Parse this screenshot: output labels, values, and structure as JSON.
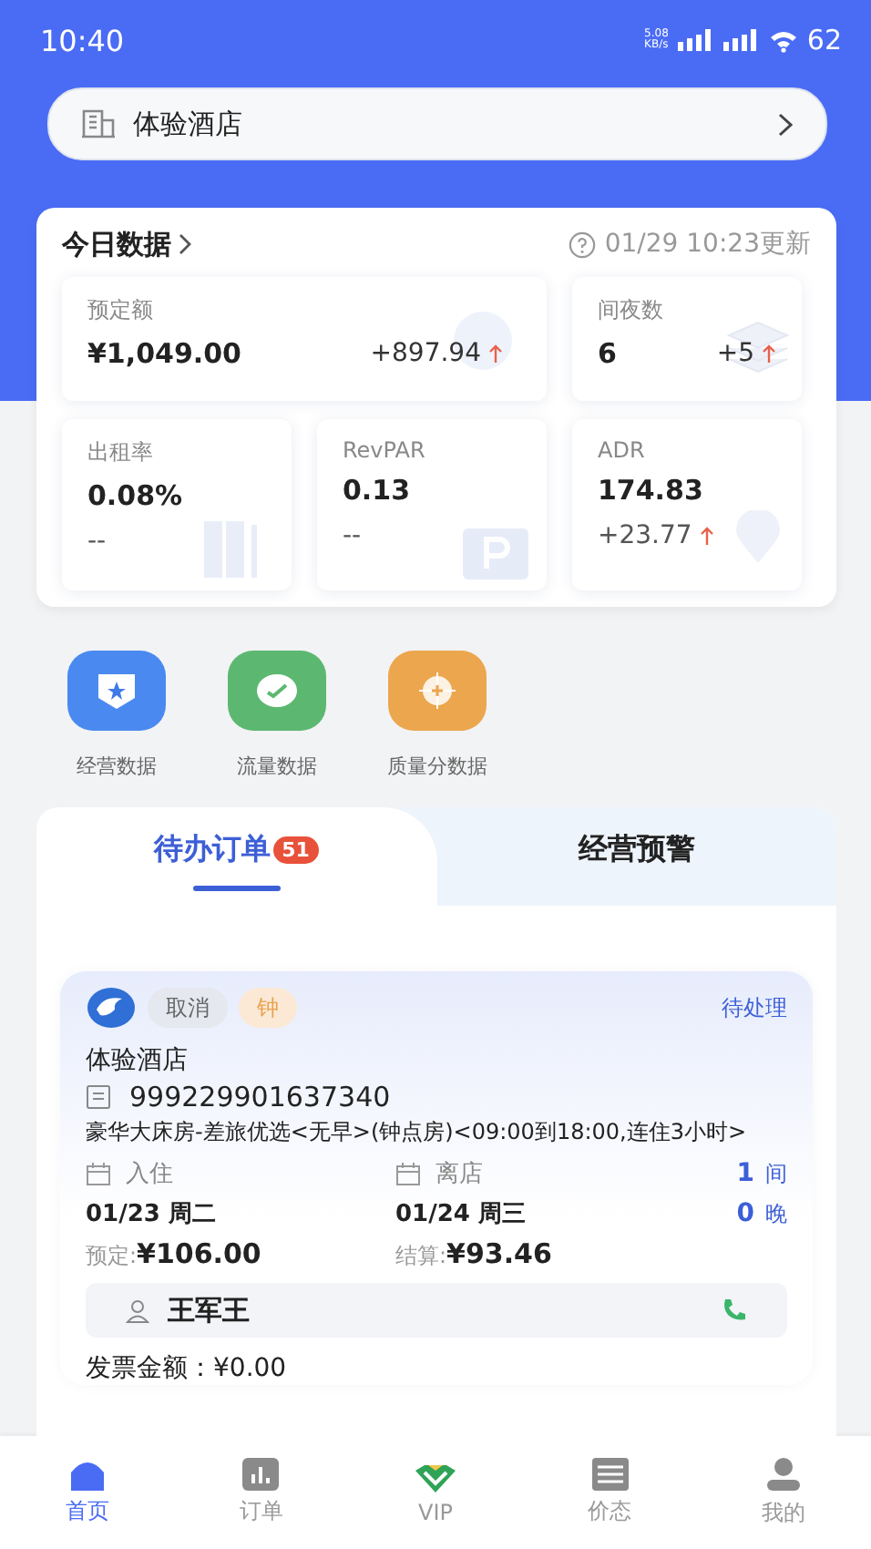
{
  "status_bar": {
    "time": "10:40",
    "net_speed": "5.08",
    "net_unit": "KB/s",
    "battery": "62"
  },
  "hotel_selector": {
    "name": "体验酒店"
  },
  "today_data": {
    "title": "今日数据",
    "updated": "01/29 10:23更新",
    "tiles": [
      {
        "label": "预定额",
        "value": "¥1,049.00",
        "change": "+897.94",
        "rising": true,
        "wide": true
      },
      {
        "label": "间夜数",
        "value": "6",
        "change": "+5",
        "rising": true,
        "wide": false
      },
      {
        "label": "出租率",
        "value": "0.08%",
        "change": "--",
        "wide": false
      },
      {
        "label": "RevPAR",
        "value": "0.13",
        "change": "--",
        "wide": false
      },
      {
        "label": "ADR",
        "value": "174.83",
        "change": "+23.77",
        "rising": true,
        "wide": false
      }
    ]
  },
  "quick_links": [
    {
      "label": "经营数据",
      "color": "#4a8af0"
    },
    {
      "label": "流量数据",
      "color": "#5cb870"
    },
    {
      "label": "质量分数据",
      "color": "#eca64e"
    }
  ],
  "tabs": [
    {
      "label": "待办订单",
      "badge": "51",
      "selected": true
    },
    {
      "label": "经营预警",
      "selected": false
    }
  ],
  "order": {
    "tags": [
      {
        "label": "取消",
        "kind": "grey"
      },
      {
        "label": "钟",
        "kind": "orange"
      }
    ],
    "status": "待处理",
    "hotel": "体验酒店",
    "order_no": "999229901637340",
    "room": "豪华大床房-差旅优选<无早>(钟点房)<09:00到18:00,连住3小时>",
    "checkin_label": "入住",
    "checkin_date": "01/23 周二",
    "checkout_label": "离店",
    "checkout_date": "01/24 周三",
    "rooms": "1",
    "rooms_unit": "间",
    "nights": "0",
    "nights_unit": "晚",
    "booked_label": "预定:",
    "booked_amount": "¥106.00",
    "settle_label": "结算:",
    "settle_amount": "¥93.46",
    "guest": "王军王",
    "invoice": "发票金额：¥0.00"
  },
  "bottom_nav": [
    {
      "label": "首页",
      "selected": true
    },
    {
      "label": "订单",
      "selected": false
    },
    {
      "label": "VIP",
      "selected": false
    },
    {
      "label": "价态",
      "selected": false
    },
    {
      "label": "我的",
      "selected": false
    }
  ]
}
